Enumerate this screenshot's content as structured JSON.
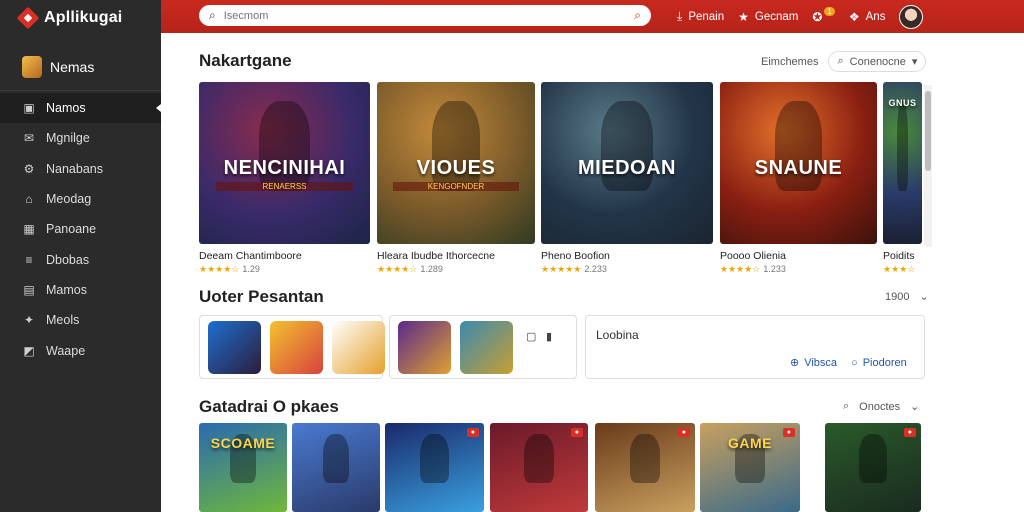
{
  "app": {
    "brand": "Apllikugai"
  },
  "sidebar": {
    "header": "Nemas",
    "items": [
      {
        "label": "Namos",
        "icon": "film-icon",
        "glyph": "▣",
        "active": true
      },
      {
        "label": "Mgnilge",
        "icon": "mail-icon",
        "glyph": "✉",
        "active": false
      },
      {
        "label": "Nanabans",
        "icon": "gear-icon",
        "glyph": "⚙",
        "active": false
      },
      {
        "label": "Meodag",
        "icon": "home-icon",
        "glyph": "⌂",
        "active": false
      },
      {
        "label": "Panoane",
        "icon": "grid-icon",
        "glyph": "▦",
        "active": false
      },
      {
        "label": "Dbobas",
        "icon": "list-icon",
        "glyph": "≡",
        "active": false
      },
      {
        "label": "Mamos",
        "icon": "folder-icon",
        "glyph": "▤",
        "active": false
      },
      {
        "label": "Meols",
        "icon": "bell-icon",
        "glyph": "✦",
        "active": false
      },
      {
        "label": "Waape",
        "icon": "image-icon",
        "glyph": "◩",
        "active": false
      }
    ]
  },
  "topbar": {
    "search_placeholder": "Isecmom",
    "actions": [
      {
        "label": "Penain",
        "icon": "download-icon",
        "glyph": "⤓"
      },
      {
        "label": "Gecnam",
        "icon": "star-icon",
        "glyph": "★"
      },
      {
        "label": "",
        "icon": "trophy-icon",
        "glyph": "✪",
        "badge": "1"
      },
      {
        "label": "Ans",
        "icon": "gift-icon",
        "glyph": "❖"
      }
    ]
  },
  "featured": {
    "title": "Nakartgane",
    "sort_label": "Eimchemes",
    "filter_label": "Conenocne",
    "cards": [
      {
        "art_title": "NENCINIHAI",
        "art_sub": "RENAERSS",
        "name": "Deeam Chantimboore",
        "stars": "★★★★☆",
        "rating": "1.29",
        "palette": [
          "#3a2a6a",
          "#8a2b4e",
          "#1b2545"
        ]
      },
      {
        "art_title": "VIOUES",
        "art_sub": "KENGOFNDER",
        "name": "Hleara Ibudbe Ithorcecne",
        "stars": "★★★★☆",
        "rating": "1.289",
        "palette": [
          "#7a5a2a",
          "#c48a3a",
          "#2f3b22"
        ]
      },
      {
        "art_title": "MIEDOAN",
        "art_sub": "",
        "name": "Pheno Boofion",
        "stars": "★★★★★",
        "rating": "2.233",
        "palette": [
          "#223548",
          "#5a7a8a",
          "#1a2430"
        ]
      },
      {
        "art_title": "SNAUNE",
        "art_sub": "",
        "name": "Poooo Olienia",
        "stars": "★★★★☆",
        "rating": "1.233",
        "palette": [
          "#8a1f12",
          "#e3702a",
          "#3b120b"
        ]
      },
      {
        "art_title": "GNUS",
        "art_sub": "",
        "name": "Poidits",
        "stars": "★★★☆",
        "rating": "",
        "palette": [
          "#2a3a6a",
          "#4a8a3a",
          "#1a2030"
        ]
      }
    ]
  },
  "latest": {
    "title": "Uoter Pesantan",
    "count": "1900",
    "group1": [
      {
        "name": "hooded-hero",
        "palette": [
          "#1f6fd0",
          "#2b1d3a"
        ]
      },
      {
        "name": "puzzle-bright",
        "palette": [
          "#f2c230",
          "#d9413c"
        ]
      },
      {
        "name": "crown-title",
        "palette": [
          "#ffffff",
          "#e5a02a"
        ]
      }
    ],
    "group2": [
      {
        "name": "purple-quest",
        "palette": [
          "#5a2a8a",
          "#e0a030"
        ]
      },
      {
        "name": "blue-golem",
        "palette": [
          "#3a8ab0",
          "#c8a030"
        ]
      }
    ],
    "info_title": "Loobina",
    "info_links": [
      {
        "label": "Vibsca",
        "glyph": "⊕"
      },
      {
        "label": "Piodoren",
        "glyph": "○"
      }
    ]
  },
  "catalog": {
    "title": "Gatadrai O pkaes",
    "filter_label": "Onoctes",
    "tiles": [
      {
        "art_title": "SCOAME",
        "badge": "",
        "palette": [
          "#2a6ab0",
          "#6fb83a"
        ]
      },
      {
        "art_title": "",
        "badge": "",
        "palette": [
          "#4a7ad0",
          "#2a3a6a"
        ]
      },
      {
        "art_title": "",
        "badge": "",
        "palette": [
          "#1a2a6a",
          "#3aa0e0"
        ]
      },
      {
        "art_title": "",
        "badge": "",
        "palette": [
          "#6a1a2a",
          "#c03a3a"
        ]
      },
      {
        "art_title": "",
        "badge": "",
        "palette": [
          "#6a3a1a",
          "#caa060"
        ]
      },
      {
        "art_title": "GAME",
        "badge": "",
        "palette": [
          "#c8a060",
          "#3a6a8a"
        ]
      },
      {
        "art_title": "",
        "badge": "",
        "palette": [
          "#2a5a2a",
          "#1a2a20"
        ]
      }
    ],
    "tile_badge_text": "●"
  },
  "colors": {
    "accent": "#c9291f",
    "sidebar": "#2b2b2b",
    "star": "#f0a500"
  }
}
